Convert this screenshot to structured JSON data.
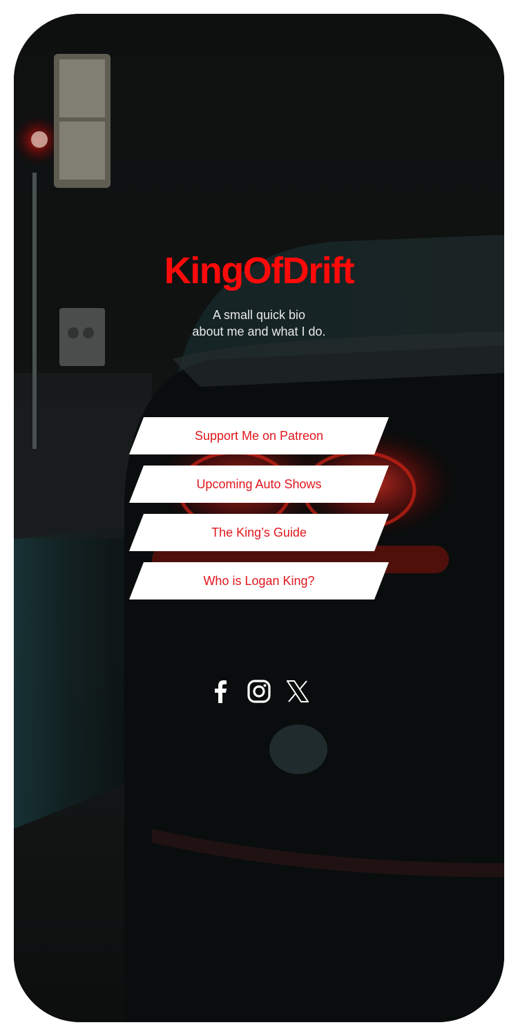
{
  "profile": {
    "name": "KingOfDrift",
    "bio_line1": "A small quick bio",
    "bio_line2": "about me and what I do."
  },
  "links": [
    {
      "label": "Support Me on Patreon"
    },
    {
      "label": "Upcoming Auto Shows"
    },
    {
      "label": "The King’s Guide"
    },
    {
      "label": "Who is Logan King?"
    }
  ],
  "social": [
    {
      "icon": "facebook-icon"
    },
    {
      "icon": "instagram-icon"
    },
    {
      "icon": "x-icon"
    }
  ],
  "colors": {
    "accent": "#ff0a0a",
    "button_bg": "#ffffff",
    "button_text": "#e0161c",
    "background": "#0b0d0d"
  }
}
